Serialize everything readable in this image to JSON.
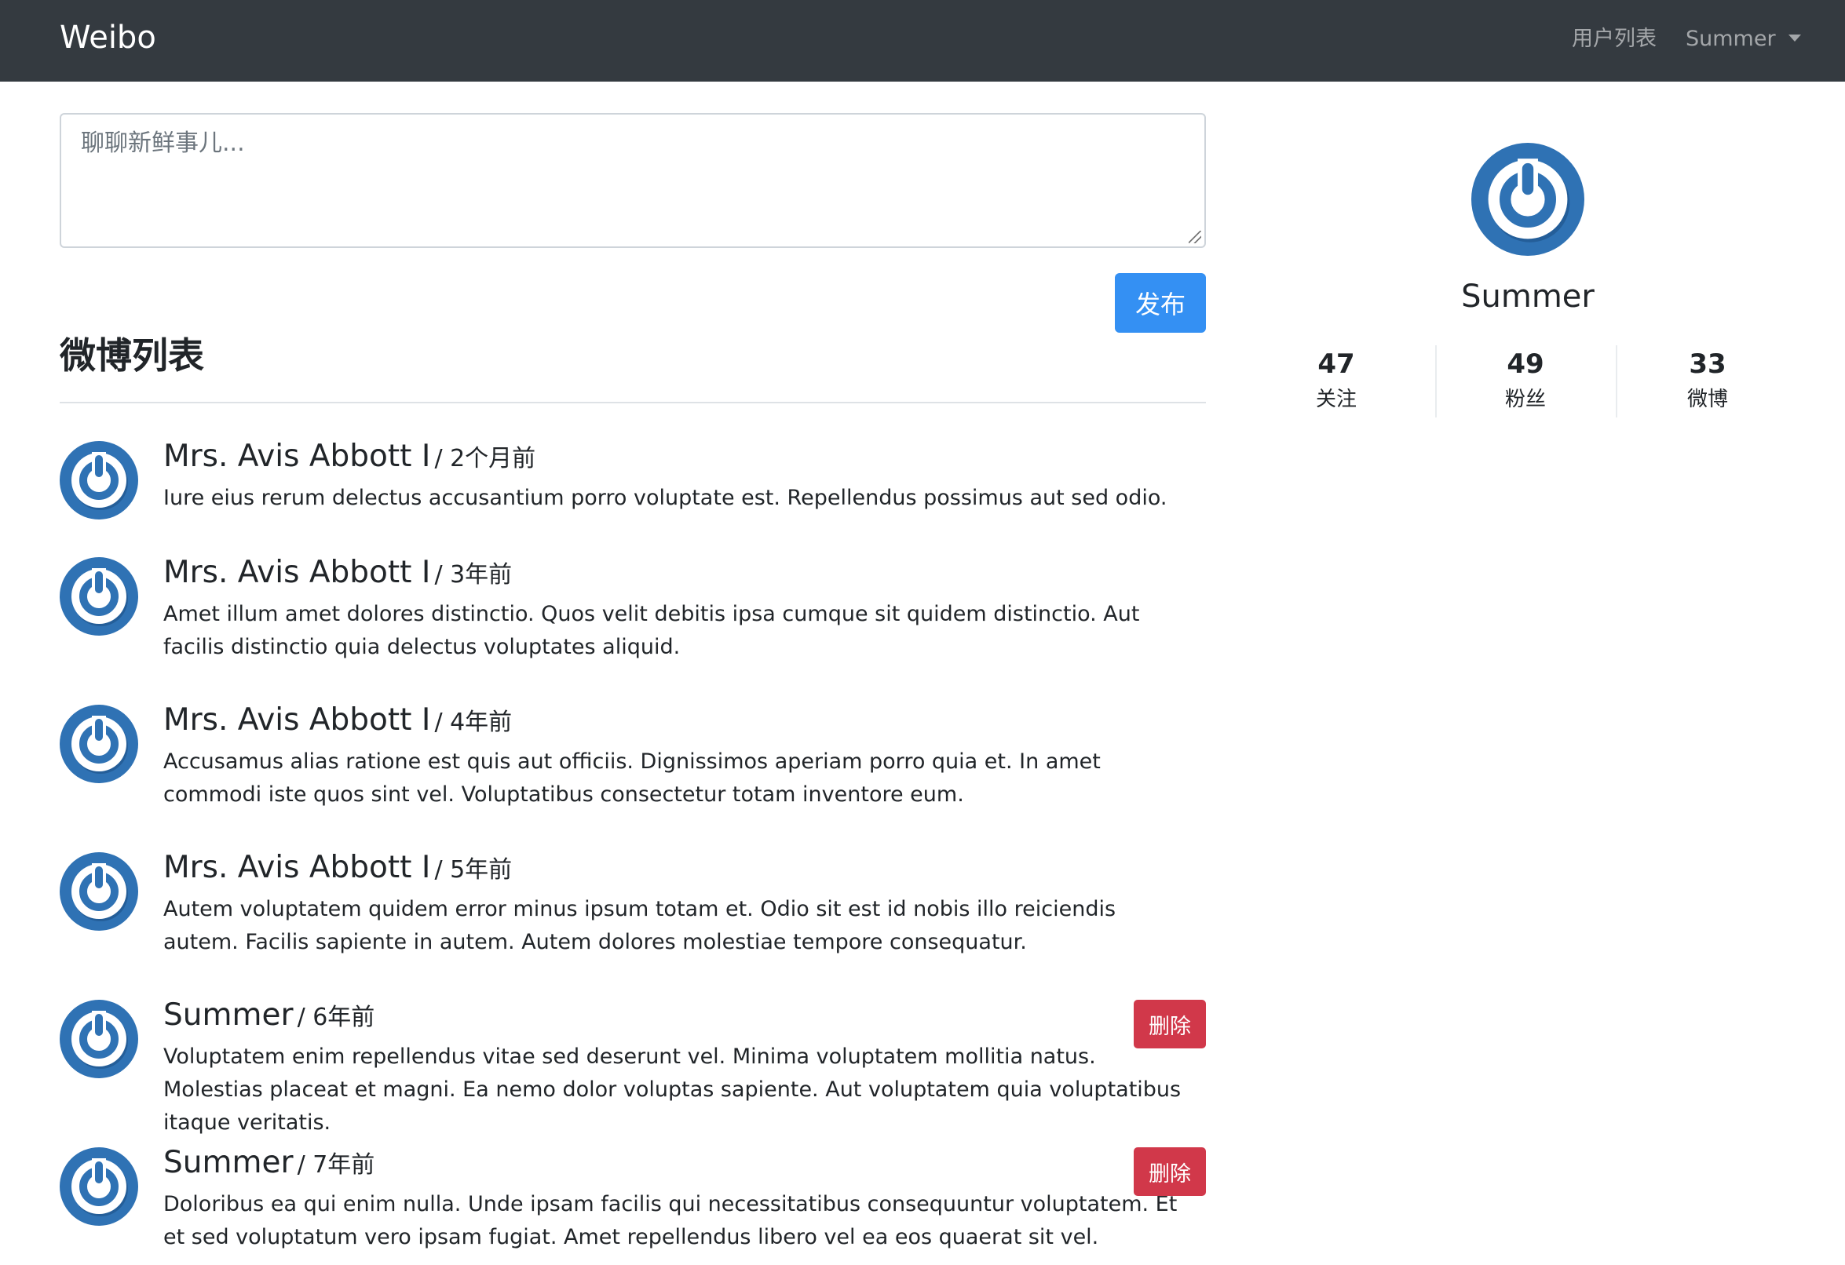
{
  "navbar": {
    "brand": "Weibo",
    "users_link": "用户列表",
    "current_user": "Summer"
  },
  "compose": {
    "placeholder": "聊聊新鲜事儿...",
    "value": "",
    "publish_label": "发布"
  },
  "feed": {
    "title": "微博列表",
    "delete_label": "删除",
    "posts": [
      {
        "author": "Mrs. Avis Abbott I",
        "time": "/ 2个月前",
        "content": "Iure eius rerum delectus accusantium porro voluptate est. Repellendus possimus aut sed odio.",
        "deletable": false
      },
      {
        "author": "Mrs. Avis Abbott I",
        "time": "/ 3年前",
        "content": "Amet illum amet dolores distinctio. Quos velit debitis ipsa cumque sit quidem distinctio. Aut facilis distinctio quia delectus voluptates aliquid.",
        "deletable": false
      },
      {
        "author": "Mrs. Avis Abbott I",
        "time": "/ 4年前",
        "content": "Accusamus alias ratione est quis aut officiis. Dignissimos aperiam porro quia et. In amet commodi iste quos sint vel. Voluptatibus consectetur totam inventore eum.",
        "deletable": false
      },
      {
        "author": "Mrs. Avis Abbott I",
        "time": "/ 5年前",
        "content": "Autem voluptatem quidem error minus ipsum totam et. Odio sit est id nobis illo reiciendis autem. Facilis sapiente in autem. Autem dolores molestiae tempore consequatur.",
        "deletable": false
      },
      {
        "author": "Summer",
        "time": "/ 6年前",
        "content": "Voluptatem enim repellendus vitae sed deserunt vel. Minima voluptatem mollitia natus. Molestias placeat et magni. Ea nemo dolor voluptas sapiente. Aut voluptatem quia voluptatibus itaque veritatis.",
        "deletable": true
      },
      {
        "author": "Summer",
        "time": "/ 7年前",
        "content": "Doloribus ea qui enim nulla. Unde ipsam facilis qui necessitatibus consequuntur voluptatem. Et et sed voluptatum vero ipsam fugiat. Amet repellendus libero vel ea eos quaerat sit vel.",
        "deletable": true
      }
    ]
  },
  "profile": {
    "name": "Summer",
    "stats": [
      {
        "value": "47",
        "label": "关注"
      },
      {
        "value": "49",
        "label": "粉丝"
      },
      {
        "value": "33",
        "label": "微博"
      }
    ]
  },
  "colors": {
    "navbar_bg": "#343a40",
    "primary": "#3490f3",
    "danger": "#d1384a",
    "avatar_blue": "#2f72b4"
  },
  "icons": {
    "avatar": "power-icon"
  }
}
